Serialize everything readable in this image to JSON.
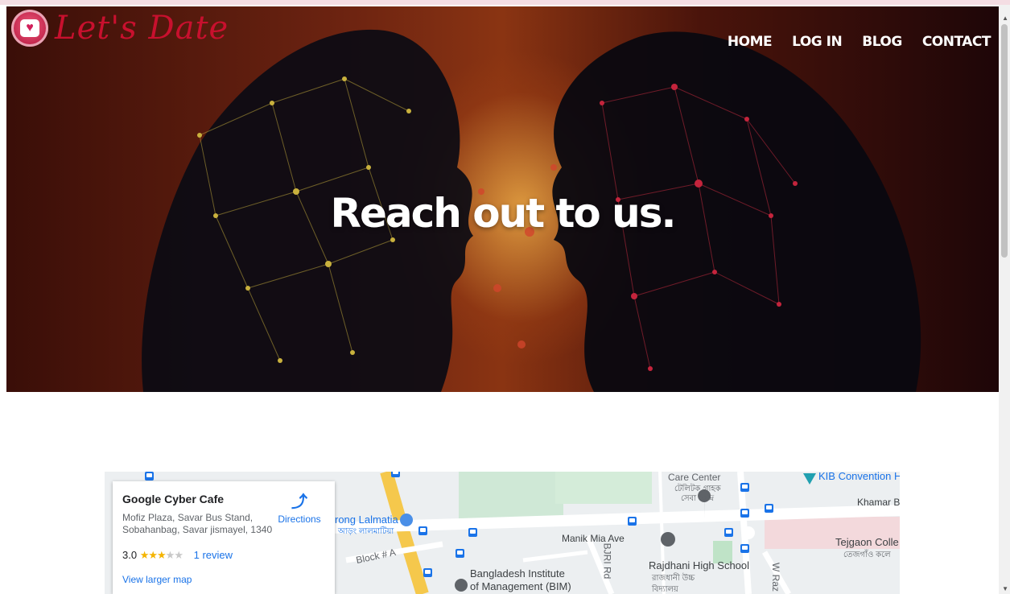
{
  "brand": {
    "name": "Let's Date",
    "logo_icon": "heart-icon"
  },
  "nav": {
    "items": [
      "HOME",
      "LOG IN",
      "BLOG",
      "CONTACT"
    ]
  },
  "hero": {
    "title": "Reach out to us."
  },
  "map": {
    "card": {
      "place_name": "Google Cyber Cafe",
      "address": "Mofiz Plaza, Savar Bus Stand, Sobahanbag, Savar jismayel, 1340",
      "rating": "3.0",
      "stars_filled": "★★★",
      "stars_empty": "★★",
      "reviews": "1 review",
      "larger_map": "View larger map",
      "directions": "Directions"
    },
    "labels": {
      "care_center": "Care Center",
      "care_center_bn": "টেলিটক গ্রাহক",
      "care_center_bn2": "সেবা কেন্দ্র",
      "kib": "KIB Convention H",
      "khamar": "Khamar Ba",
      "lalmatia": "rong Lalmatia",
      "lalmatia_bn": "আড়ং লালমাটিয়া",
      "manik": "Manik Mia Ave",
      "block": "Block # A",
      "bjri": "BJRI Rd",
      "rajdhani": "Rajdhani High School",
      "rajdhani_bn": "রাজধানী উচ্চ",
      "rajdhani_bn2": "বিদ্যালয়",
      "tejgaon": "Tejgaon Colle",
      "tejgaon_bn": "তেজগাঁও কলে",
      "bim1": "Bangladesh Institute",
      "bim2": "of Management (BIM)",
      "w_raz": "W Raz"
    }
  },
  "colors": {
    "brand_red": "#c8102e",
    "link_blue": "#1a73e8",
    "star_gold": "#f4b400"
  }
}
